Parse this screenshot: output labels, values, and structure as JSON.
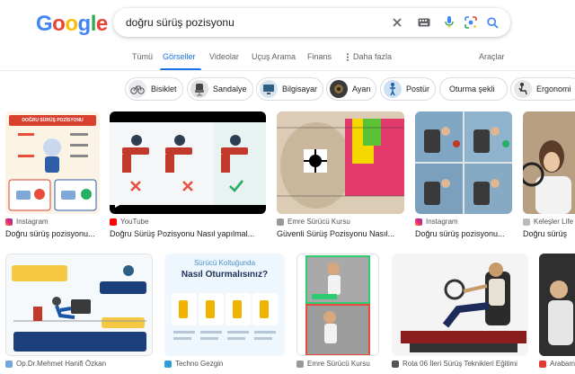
{
  "logo": {
    "letters": [
      "G",
      "o",
      "o",
      "g",
      "l",
      "e"
    ],
    "colors": [
      "#4285f4",
      "#ea4335",
      "#fbbc05",
      "#4285f4",
      "#34a853",
      "#ea4335"
    ]
  },
  "search": {
    "query": "doğru sürüş pozisyonu"
  },
  "tabs": [
    {
      "label": "Tümü",
      "active": false
    },
    {
      "label": "Görseller",
      "active": true
    },
    {
      "label": "Videolar",
      "active": false
    },
    {
      "label": "Uçuş Arama",
      "active": false
    },
    {
      "label": "Finans",
      "active": false
    },
    {
      "label": "Daha fazla",
      "active": false
    }
  ],
  "tools_label": "Araçlar",
  "chips": [
    "Bisiklet",
    "Sandalye",
    "Bilgisayar",
    "Ayarı",
    "Postür",
    "Oturma şekli",
    "Ergonomi"
  ],
  "colors": {
    "accent": "#1a73e8",
    "youtube": "#ff0000",
    "instagram": "#e1306c"
  },
  "row1": [
    {
      "source": "Instagram",
      "title": "Doğru sürüş pozisyonu...",
      "thumb_text": "DOĞRU SÜRÜŞ POZİSYONU"
    },
    {
      "source": "YouTube",
      "title": "Doğru Sürüş Pozisyonu Nasıl yapılmal..."
    },
    {
      "source": "Emre Sürücü Kursu",
      "title": "Güvenli Sürüş Pozisyonu Nasıl..."
    },
    {
      "source": "Instagram",
      "title": "Doğru sürüş pozisyonu..."
    },
    {
      "source": "Keleşler Life",
      "title": "Doğru sürüş"
    }
  ],
  "row2": [
    {
      "source": "Op.Dr.Mehmet Hanifi Özkan"
    },
    {
      "source": "Techno Gezgin",
      "thumb_title": "Sürücü Koltuğunda",
      "thumb_sub": "Nasıl Oturmalısınız?"
    },
    {
      "source": "Emre Sürücü Kursu"
    },
    {
      "source": "Rota 06 İleri Sürüş Teknikleri Eğitimi"
    },
    {
      "source": "Arabam"
    }
  ]
}
